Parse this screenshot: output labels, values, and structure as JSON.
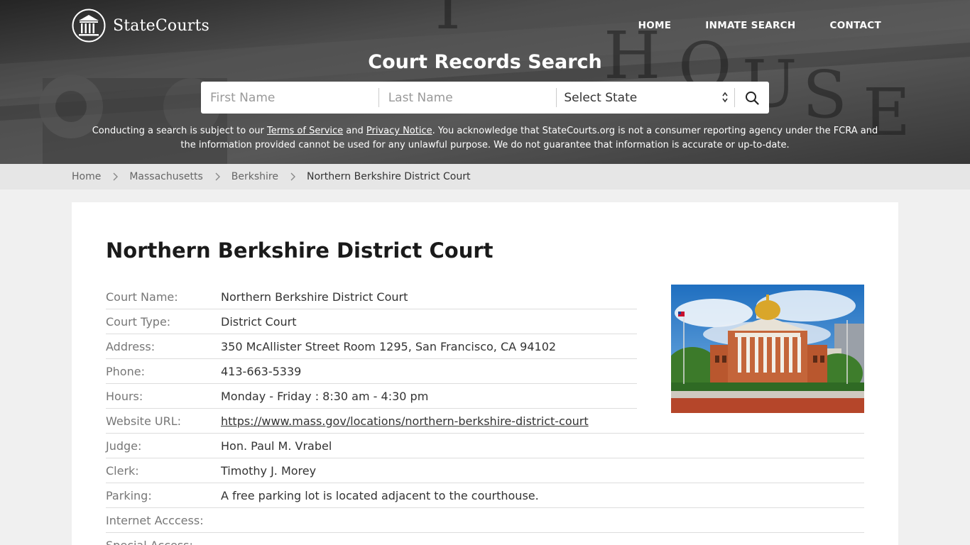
{
  "brand": {
    "name": "StateCourts"
  },
  "nav": {
    "home": "HOME",
    "inmate": "INMATE SEARCH",
    "contact": "CONTACT"
  },
  "hero": {
    "title": "Court Records Search",
    "first_name_placeholder": "First Name",
    "last_name_placeholder": "Last Name",
    "state_select": "Select State"
  },
  "disclaimer": {
    "part1": "Conducting a search is subject to our ",
    "tos": "Terms of Service",
    "part2": " and ",
    "privacy": "Privacy Notice",
    "part3": ". You acknowledge that StateCourts.org is not a consumer reporting agency under the FCRA and the information provided cannot be used for any unlawful purpose. We do not guarantee that information is accurate or up-to-date."
  },
  "breadcrumb": {
    "home": "Home",
    "state": "Massachusetts",
    "county": "Berkshire",
    "current": "Northern Berkshire District Court"
  },
  "court": {
    "title": "Northern Berkshire District Court",
    "rows": [
      {
        "label": "Court Name:",
        "value": "Northern Berkshire District Court"
      },
      {
        "label": "Court Type:",
        "value": "District Court"
      },
      {
        "label": "Address:",
        "value": "350 McAllister Street Room 1295, San Francisco, CA 94102"
      },
      {
        "label": "Phone:",
        "value": "413-663-5339"
      },
      {
        "label": "Hours:",
        "value": "Monday - Friday : 8:30 am - 4:30 pm"
      },
      {
        "label": "Website URL:",
        "value": "https://www.mass.gov/locations/northern-berkshire-district-court"
      },
      {
        "label": "Judge:",
        "value": "Hon. Paul M. Vrabel"
      },
      {
        "label": "Clerk:",
        "value": "Timothy J. Morey"
      },
      {
        "label": "Parking:",
        "value": "A free parking lot is located adjacent to the courthouse."
      },
      {
        "label": "Internet Acccess:",
        "value": ""
      },
      {
        "label": "Special Access:",
        "value": ""
      }
    ]
  },
  "icons": {
    "logo": "courthouse-columns-icon",
    "search": "search-icon",
    "select_arrow": "select-arrows-icon",
    "breadcrumb_sep": "chevron-right-icon"
  },
  "colors": {
    "hero_overlay": "#3a3a3a",
    "breadcrumb_bg": "#e6e6e6",
    "page_bg": "#f0f0f0",
    "card_bg": "#ffffff"
  }
}
